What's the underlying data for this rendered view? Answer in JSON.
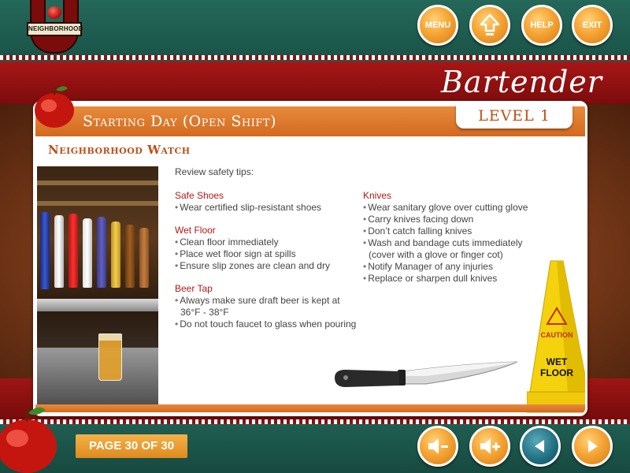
{
  "logo": {
    "text": "NEIGHBORHOOD"
  },
  "header": {
    "buttons": [
      {
        "id": "menu",
        "label": "MENU"
      },
      {
        "id": "home",
        "icon": "home-arrow-icon"
      },
      {
        "id": "help",
        "label": "HELP"
      },
      {
        "id": "exit",
        "label": "EXIT"
      }
    ]
  },
  "course": {
    "name": "Bartender",
    "level": "LEVEL 1"
  },
  "lesson": {
    "title": "Starting Day (Open Shift)",
    "section": "Neighborhood Watch",
    "intro": "Review safety tips:",
    "left_groups": [
      {
        "heading": "Safe Shoes",
        "items": [
          "Wear certified slip-resistant shoes"
        ]
      },
      {
        "heading": "Wet Floor",
        "items": [
          "Clean floor immediately",
          "Place wet floor sign at spills",
          "Ensure slip zones are clean and dry"
        ]
      },
      {
        "heading": "Beer Tap",
        "items": [
          "Always make sure draft beer is kept at 36°F - 38°F",
          "Do not touch faucet to glass when pouring"
        ]
      }
    ],
    "right_groups": [
      {
        "heading": "Knives",
        "items": [
          "Wear sanitary glove over cutting glove",
          "Carry knives facing down",
          "Don’t catch falling knives",
          "Wash and bandage cuts immediately (cover with a glove or finger cot)",
          "Notify Manager of any injuries",
          "Replace or sharpen dull knives"
        ]
      }
    ],
    "cone": {
      "line1": "CAUTION",
      "line2": "WET",
      "line3": "FLOOR"
    }
  },
  "footer": {
    "page_indicator": "PAGE 30 OF 30",
    "buttons": [
      {
        "id": "volume-down",
        "icon": "volume-down-icon"
      },
      {
        "id": "volume-up",
        "icon": "volume-up-icon"
      },
      {
        "id": "back",
        "icon": "back-arrow-icon"
      },
      {
        "id": "next",
        "icon": "next-arrow-icon"
      }
    ]
  },
  "colors": {
    "accent": "#e0801e",
    "brand_green": "#1e5a4e",
    "brand_red": "#a01515",
    "heading_red": "#b01818"
  }
}
